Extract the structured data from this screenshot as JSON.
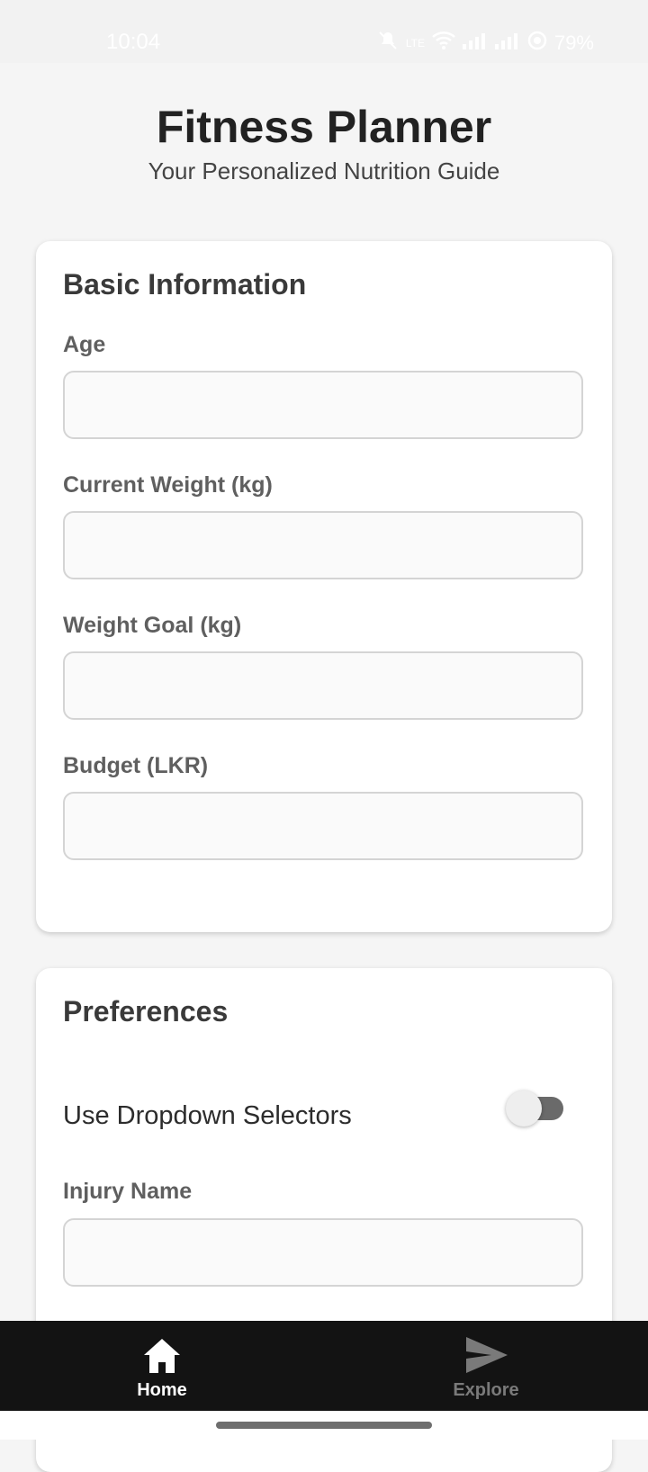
{
  "status_bar": {
    "time": "10:04",
    "network": "LTE",
    "battery": "79%"
  },
  "header": {
    "title": "Fitness Planner",
    "subtitle": "Your Personalized Nutrition Guide"
  },
  "basic_info": {
    "title": "Basic Information",
    "fields": [
      {
        "label": "Age",
        "value": "",
        "placeholder": ""
      },
      {
        "label": "Current Weight (kg)",
        "value": "",
        "placeholder": ""
      },
      {
        "label": "Weight Goal (kg)",
        "value": "",
        "placeholder": ""
      },
      {
        "label": "Budget (LKR)",
        "value": "",
        "placeholder": ""
      }
    ]
  },
  "preferences": {
    "title": "Preferences",
    "toggle_label": "Use Dropdown Selectors",
    "toggle_on": false,
    "injury_label": "Injury Name",
    "injury_value": ""
  },
  "bottom_nav": {
    "items": [
      {
        "label": "Home",
        "icon": "home-icon",
        "active": true
      },
      {
        "label": "Explore",
        "icon": "send-icon",
        "active": false
      }
    ]
  },
  "colors": {
    "background": "#f5f5f5",
    "card": "#ffffff",
    "nav_bar": "#131313",
    "nav_active": "#ffffff",
    "nav_inactive": "#7a7a7a"
  }
}
